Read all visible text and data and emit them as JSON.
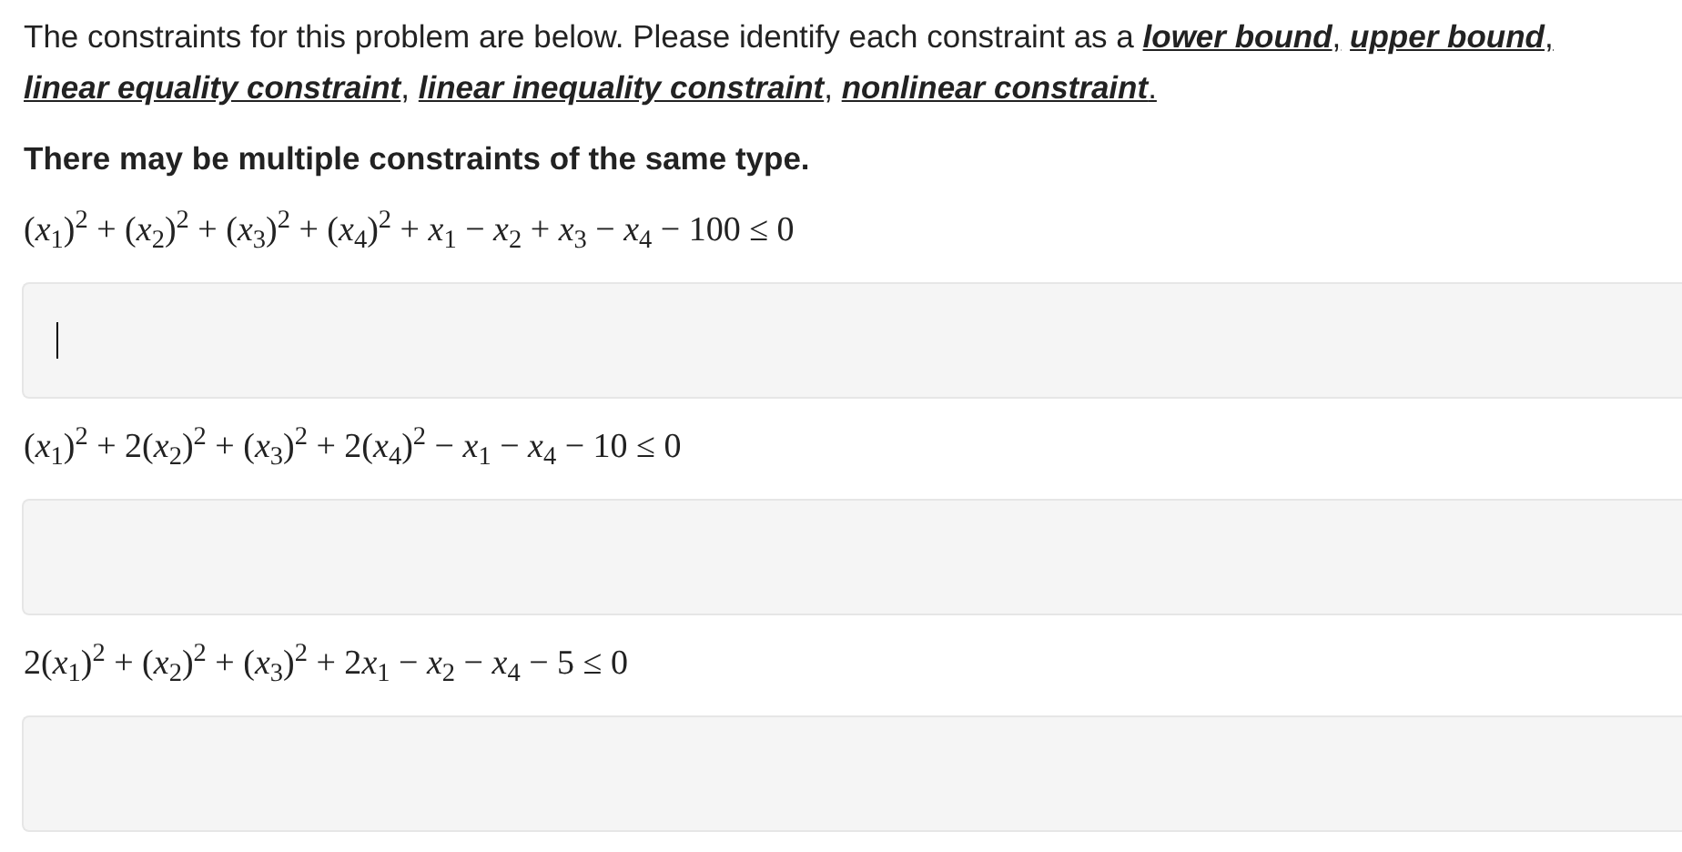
{
  "instructions": {
    "text": "The constraints for this problem are below. Please identify each constraint as a",
    "terms": [
      {
        "text": "lower bound",
        "suffix": ","
      },
      {
        "text": "upper bound",
        "suffix": ","
      },
      {
        "text": "linear equality constraint",
        "suffix": ","
      },
      {
        "text": "linear inequality constraint",
        "suffix": ","
      },
      {
        "text": "nonlinear constraint",
        "suffix": "."
      }
    ]
  },
  "note": "There may be multiple constraints of the same type.",
  "constraints": [
    {
      "formula": "(x$_{1}$)$^{2}$ + (x$_{2}$)$^{2}$ + (x$_{3}$)$^{2}$ + (x$_{4}$)$^{2}$ + x$_{1}$ − x$_{2}$ + x$_{3}$ − x$_{4}$ − 100 ≤ 0",
      "answer": {
        "focused": true
      }
    },
    {
      "formula": "(x$_{1}$)$^{2}$ + 2(x$_{2}$)$^{2}$ + (x$_{3}$)$^{2}$ + 2(x$_{4}$)$^{2}$ − x$_{1}$ − x$_{4}$ − 10 ≤ 0",
      "answer": {
        "focused": false
      }
    },
    {
      "formula": "2(x$_{1}$)$^{2}$ + (x$_{2}$)$^{2}$ + (x$_{3}$)$^{2}$ + 2x$_{1}$ − x$_{2}$ − x$_{4}$ − 5 ≤ 0",
      "answer": {
        "focused": false
      }
    }
  ]
}
